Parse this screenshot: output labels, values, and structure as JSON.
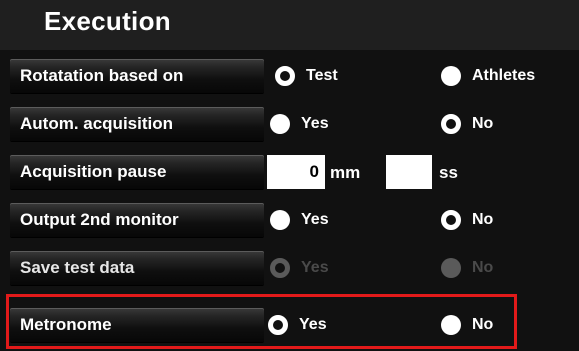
{
  "section": {
    "title": "Execution"
  },
  "rows": [
    {
      "label": "Rotatation based on",
      "options": [
        {
          "label": "Test",
          "selected": true,
          "enabled": true,
          "icon": "radio-selected"
        },
        {
          "label": "Athletes",
          "selected": false,
          "enabled": true,
          "icon": "radio-unselected"
        }
      ]
    },
    {
      "label": "Autom. acquisition",
      "options": [
        {
          "label": "Yes",
          "selected": false,
          "enabled": true,
          "icon": "radio-unselected"
        },
        {
          "label": "No",
          "selected": true,
          "enabled": true,
          "icon": "radio-selected"
        }
      ]
    },
    {
      "label": "Acquisition pause",
      "minutes": {
        "value": "0",
        "unit": "mm"
      },
      "seconds": {
        "value": "",
        "unit": "ss"
      }
    },
    {
      "label": "Output 2nd monitor",
      "options": [
        {
          "label": "Yes",
          "selected": false,
          "enabled": true,
          "icon": "radio-unselected"
        },
        {
          "label": "No",
          "selected": true,
          "enabled": true,
          "icon": "radio-selected"
        }
      ]
    },
    {
      "label": "Save test data",
      "options": [
        {
          "label": "Yes",
          "selected": true,
          "enabled": false,
          "icon": "radio-selected"
        },
        {
          "label": "No",
          "selected": false,
          "enabled": false,
          "icon": "radio-unselected"
        }
      ]
    },
    {
      "label": "Metronome",
      "options": [
        {
          "label": "Yes",
          "selected": true,
          "enabled": true,
          "icon": "radio-selected"
        },
        {
          "label": "No",
          "selected": false,
          "enabled": true,
          "icon": "radio-unselected"
        }
      ]
    }
  ],
  "colors": {
    "background": "#111111",
    "header": "#1f1f1f",
    "highlight": "#e21a1a",
    "disabled": "#5a5a5a"
  }
}
